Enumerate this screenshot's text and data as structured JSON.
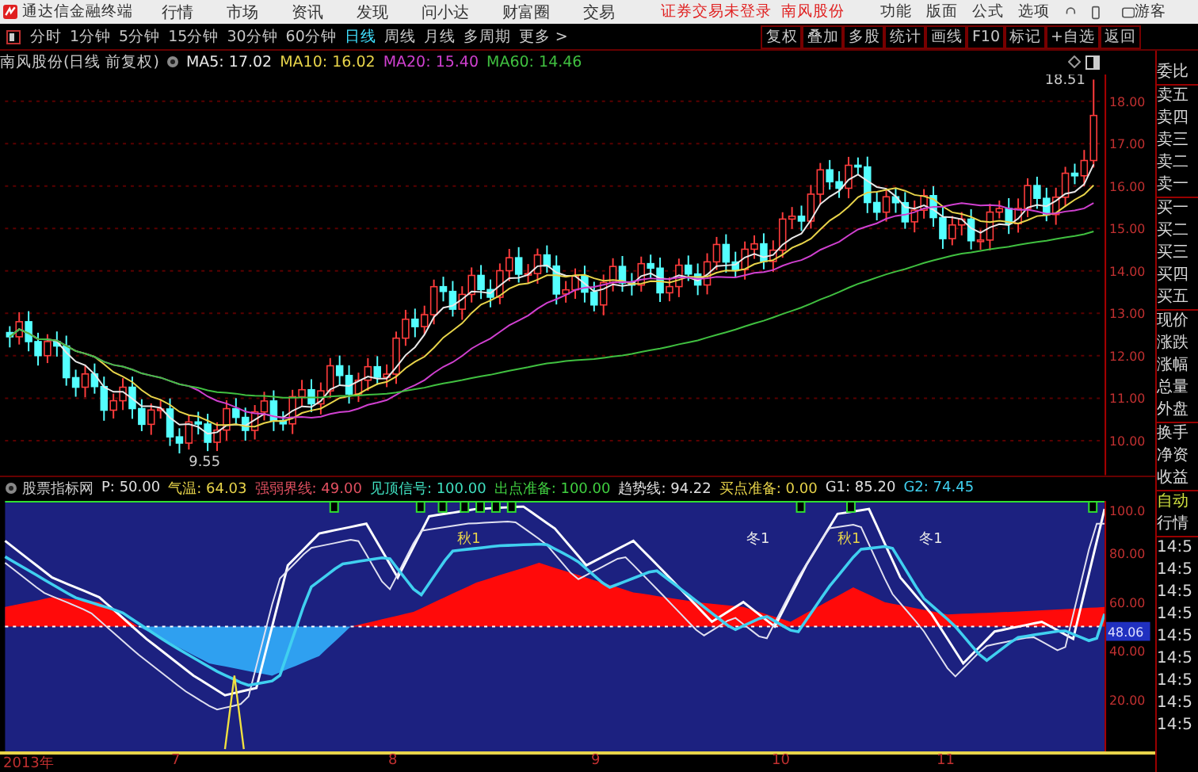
{
  "app": {
    "title": "通达信金融终端"
  },
  "menu": [
    "行情",
    "市场",
    "资讯",
    "发现",
    "问小达",
    "财富圈",
    "交易"
  ],
  "status": {
    "login": "证券交易未登录",
    "stock": "南风股份"
  },
  "tools": [
    "功能",
    "版面",
    "公式",
    "选项"
  ],
  "user": "游客",
  "periods": [
    {
      "label": "分时",
      "selected": false
    },
    {
      "label": "1分钟",
      "selected": false
    },
    {
      "label": "5分钟",
      "selected": false
    },
    {
      "label": "15分钟",
      "selected": false
    },
    {
      "label": "30分钟",
      "selected": false
    },
    {
      "label": "60分钟",
      "selected": false
    },
    {
      "label": "日线",
      "selected": true
    },
    {
      "label": "周线",
      "selected": false
    },
    {
      "label": "月线",
      "selected": false
    },
    {
      "label": "多周期",
      "selected": false
    },
    {
      "label": "更多 >",
      "selected": false
    }
  ],
  "actions": [
    "复权",
    "叠加",
    "多股",
    "统计",
    "画线",
    "F10",
    "标记",
    "+自选",
    "返回"
  ],
  "main_chart": {
    "title": "南风股份(日线 前复权)",
    "mas": [
      {
        "label": "MA5: 17.02",
        "color": "#e8e8e8"
      },
      {
        "label": "MA10: 16.02",
        "color": "#e8d44a"
      },
      {
        "label": "MA20: 15.40",
        "color": "#d040d0"
      },
      {
        "label": "MA60: 14.46",
        "color": "#40c040"
      }
    ],
    "high_label": "18.51",
    "low_label": "9.55",
    "yticks": [
      "18.00",
      "17.00",
      "16.00",
      "15.00",
      "14.00",
      "13.00",
      "12.00",
      "11.00",
      "10.00"
    ]
  },
  "indicator": {
    "name": "股票指标网",
    "params": [
      {
        "label": "P: 50.00",
        "color": "#e0e0e0"
      },
      {
        "label": "气温: 64.03",
        "color": "#e8d44a"
      },
      {
        "label": "强弱界线: 49.00",
        "color": "#e05060"
      },
      {
        "label": "见顶信号: 100.00",
        "color": "#40e0c0"
      },
      {
        "label": "出点准备: 100.00",
        "color": "#40d040"
      },
      {
        "label": "趋势线: 94.22",
        "color": "#e0e0e0"
      },
      {
        "label": "买点准备: 0.00",
        "color": "#e8d44a"
      },
      {
        "label": "G1: 85.20",
        "color": "#e0e0e0"
      },
      {
        "label": "G2: 74.45",
        "color": "#40d0f0"
      }
    ]
  },
  "lower_chart": {
    "yticks": [
      "100.0",
      "80.00",
      "60.00",
      "40.00",
      "20.00"
    ],
    "current": "48.06",
    "labels": [
      {
        "text": "秋1",
        "color": "#e8d44a"
      },
      {
        "text": "冬1",
        "color": "#e8e8e8"
      },
      {
        "text": "秋1",
        "color": "#e8d44a"
      },
      {
        "text": "冬1",
        "color": "#e8e8e8"
      }
    ]
  },
  "x_axis": [
    "2013年",
    "7",
    "8",
    "9",
    "10",
    "11"
  ],
  "quote_panel": {
    "groups": [
      [
        "委比"
      ],
      [
        "卖五",
        "卖四",
        "卖三",
        "卖二",
        "卖一"
      ],
      [
        "买一",
        "买二",
        "买三",
        "买四",
        "买五"
      ],
      [
        "现价",
        "涨跌",
        "涨幅",
        "总量",
        "外盘"
      ],
      [
        "换手",
        "净资",
        "收益"
      ]
    ],
    "mode": [
      "自动",
      "行情"
    ],
    "times": [
      "14:5",
      "14:5",
      "14:5",
      "14:5",
      "14:5",
      "14:5",
      "14:5",
      "14:5",
      "14:5"
    ]
  }
}
